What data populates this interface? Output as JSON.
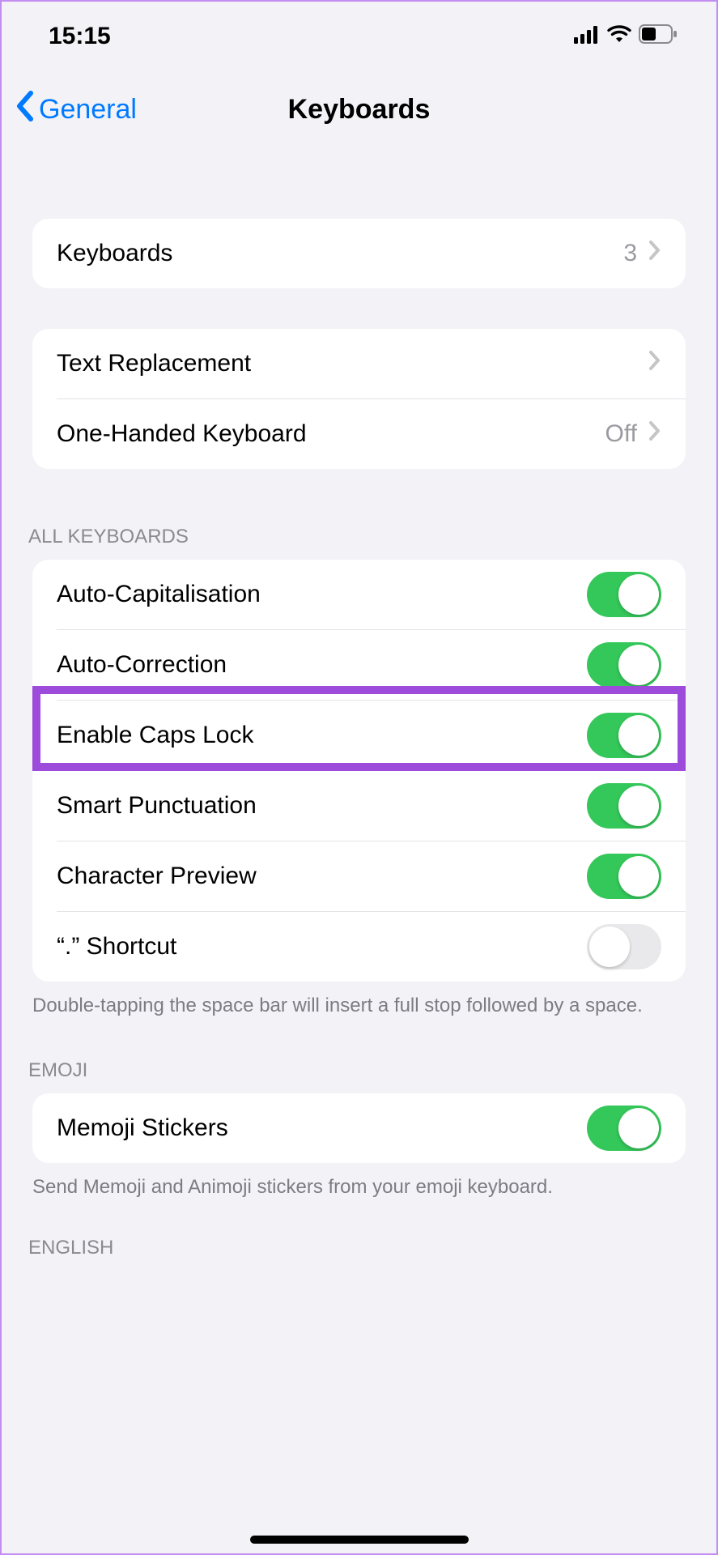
{
  "status_bar": {
    "time": "15:15"
  },
  "nav": {
    "back_label": "General",
    "title": "Keyboards"
  },
  "group_keyboards": {
    "items": [
      {
        "label": "Keyboards",
        "value": "3"
      }
    ]
  },
  "group_text": {
    "items": [
      {
        "label": "Text Replacement",
        "value": ""
      },
      {
        "label": "One-Handed Keyboard",
        "value": "Off"
      }
    ]
  },
  "section_all_keyboards": {
    "header": "ALL KEYBOARDS",
    "items": [
      {
        "label": "Auto-Capitalisation",
        "on": true
      },
      {
        "label": "Auto-Correction",
        "on": true
      },
      {
        "label": "Enable Caps Lock",
        "on": true
      },
      {
        "label": "Smart Punctuation",
        "on": true
      },
      {
        "label": "Character Preview",
        "on": true
      },
      {
        "label": "“.” Shortcut",
        "on": false
      }
    ],
    "footer": "Double-tapping the space bar will insert a full stop followed by a space."
  },
  "section_emoji": {
    "header": "EMOJI",
    "items": [
      {
        "label": "Memoji Stickers",
        "on": true
      }
    ],
    "footer": "Send Memoji and Animoji stickers from your emoji keyboard."
  },
  "section_english": {
    "header": "ENGLISH"
  }
}
